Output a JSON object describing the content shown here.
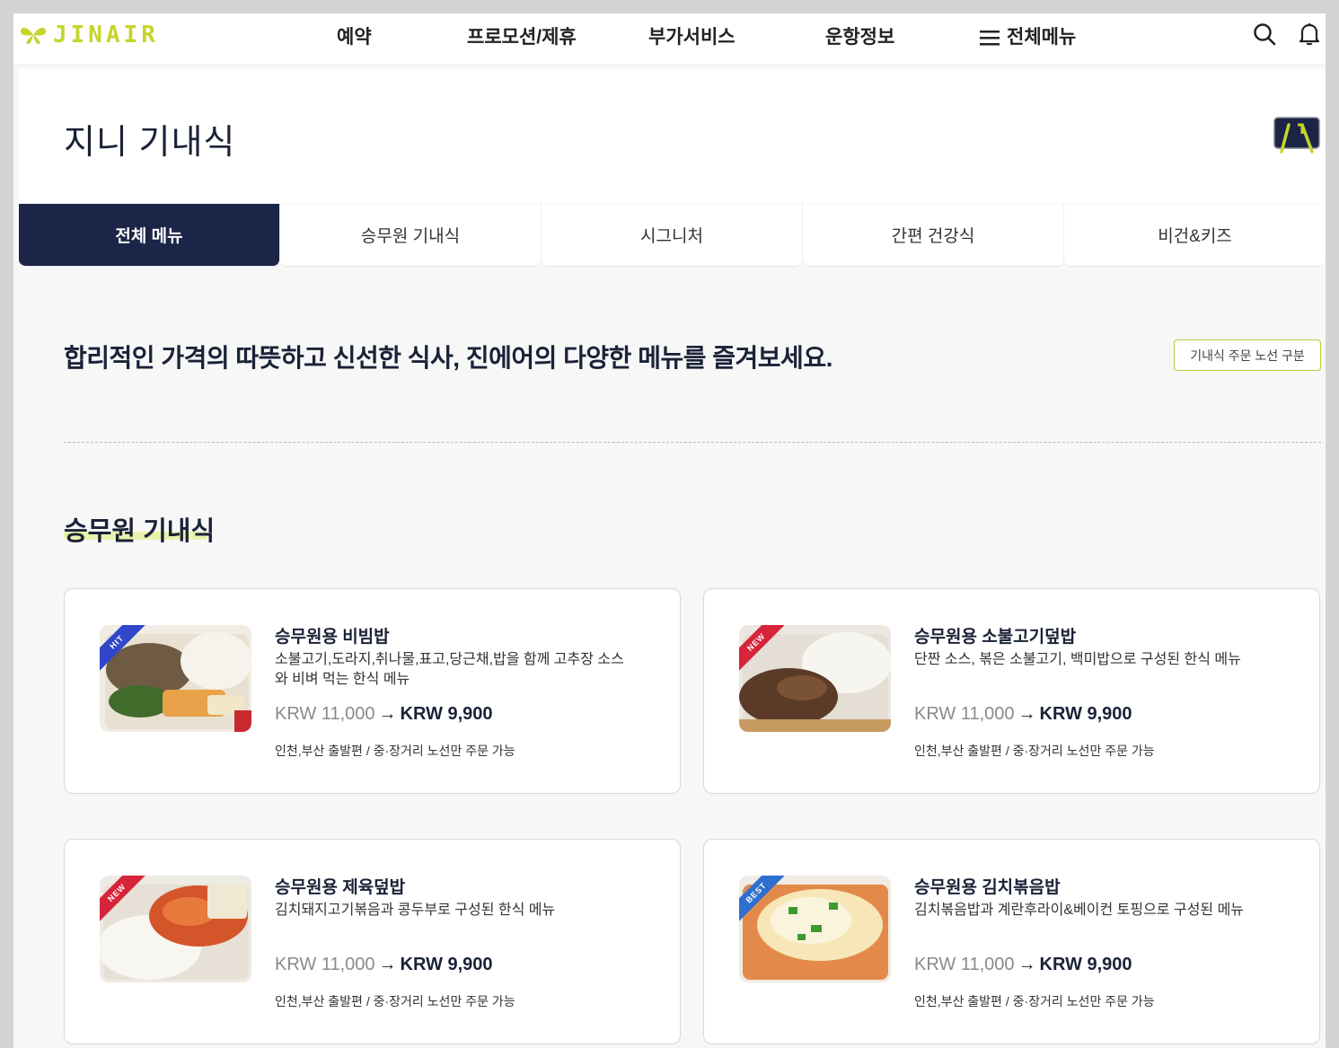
{
  "header": {
    "logo_text": "JINAIR",
    "nav": [
      "예약",
      "프로모션/제휴",
      "부가서비스",
      "운항정보",
      "전체메뉴"
    ],
    "icons": [
      "search-icon",
      "bell-icon"
    ]
  },
  "page": {
    "title": "지니 기내식"
  },
  "tabs": [
    "전체 메뉴",
    "승무원 기내식",
    "시그니처",
    "간편 건강식",
    "비건&키즈"
  ],
  "headline": "합리적인 가격의 따뜻하고 신선한 식사, 진에어의 다양한 메뉴를 즐겨보세요.",
  "route_button": "기내식 주문 노선 구분",
  "section": {
    "title": "승무원 기내식"
  },
  "cards": [
    {
      "badge": "HIT",
      "name": "승무원용 비빔밥",
      "desc": "소불고기,도라지,취나물,표고,당근채,밥을 함께 고추장 소스와 비벼 먹는 한식 메뉴",
      "old_price": "KRW 11,000",
      "new_price": "KRW 9,900",
      "note": "인천,부산 출발편 / 중·장거리 노선만 주문 가능"
    },
    {
      "badge": "NEW",
      "name": "승무원용 소불고기덮밥",
      "desc": "단짠 소스, 볶은 소불고기, 백미밥으로 구성된 한식 메뉴",
      "old_price": "KRW 11,000",
      "new_price": "KRW 9,900",
      "note": "인천,부산 출발편 / 중·장거리 노선만 주문 가능"
    },
    {
      "badge": "NEW",
      "name": "승무원용 제육덮밥",
      "desc": "김치돼지고기볶음과 콩두부로 구성된 한식 메뉴",
      "old_price": "KRW 11,000",
      "new_price": "KRW 9,900",
      "note": "인천,부산 출발편 / 중·장거리 노선만 주문 가능"
    },
    {
      "badge": "BEST",
      "name": "승무원용 김치볶음밥",
      "desc": "김치볶음밥과 계란후라이&베이컨 토핑으로 구성된 메뉴",
      "old_price": "KRW 11,000",
      "new_price": "KRW 9,900",
      "note": "인천,부산 출발편 / 중·장거리 노선만 주문 가능"
    }
  ],
  "colors": {
    "navy": "#1b2547",
    "lime": "#c5d52e",
    "badge_hit": "#2f47c8",
    "badge_new": "#d6243a",
    "badge_best": "#2f6fd0"
  }
}
